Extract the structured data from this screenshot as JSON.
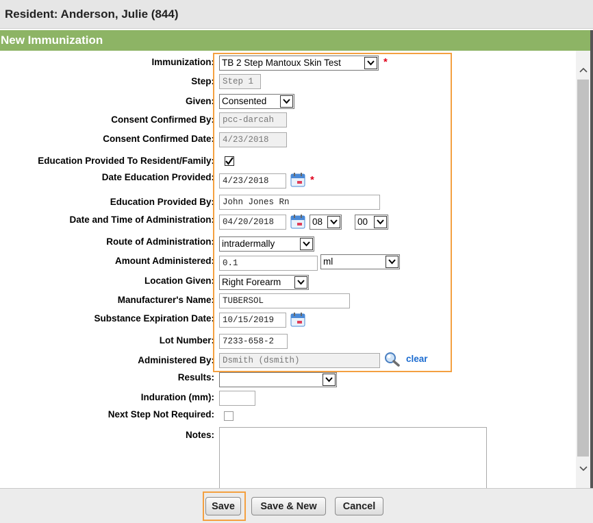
{
  "header": {
    "title": "Resident: Anderson, Julie (844)"
  },
  "section": {
    "title": "New Immunization"
  },
  "form": {
    "immunization": {
      "label": "Immunization:",
      "value": "TB 2 Step Mantoux Skin Test"
    },
    "step": {
      "label": "Step:",
      "value": "Step 1"
    },
    "given": {
      "label": "Given:",
      "value": "Consented"
    },
    "consent_by": {
      "label": "Consent Confirmed By:",
      "value": "pcc-darcah"
    },
    "consent_date": {
      "label": "Consent Confirmed Date:",
      "value": "4/23/2018"
    },
    "education_provided": {
      "label": "Education Provided To Resident/Family:",
      "checked": true
    },
    "date_education": {
      "label": "Date Education Provided:",
      "value": "4/23/2018"
    },
    "education_by": {
      "label": "Education Provided By:",
      "value": "John Jones Rn"
    },
    "admin_datetime": {
      "label": "Date and Time of Administration:",
      "date": "04/20/2018",
      "hour": "08",
      "minute": "00"
    },
    "route": {
      "label": "Route of Administration:",
      "value": "intradermally"
    },
    "amount": {
      "label": "Amount Administered:",
      "value": "0.1",
      "unit": "ml"
    },
    "location": {
      "label": "Location Given:",
      "value": "Right Forearm"
    },
    "manufacturer": {
      "label": "Manufacturer's Name:",
      "value": "TUBERSOL"
    },
    "expiration": {
      "label": "Substance Expiration Date:",
      "value": "10/15/2019"
    },
    "lot": {
      "label": "Lot Number:",
      "value": "7233-658-2"
    },
    "administered_by": {
      "label": "Administered By:",
      "value": "Dsmith (dsmith)",
      "clear_label": "clear"
    },
    "results": {
      "label": "Results:",
      "value": ""
    },
    "induration": {
      "label": "Induration (mm):",
      "value": ""
    },
    "next_step": {
      "label": "Next Step Not Required:",
      "checked": false
    },
    "notes": {
      "label": "Notes:",
      "value": ""
    },
    "required_mark": "*"
  },
  "footer": {
    "save_label": "Save",
    "save_new_label": "Save & New",
    "cancel_label": "Cancel"
  },
  "colors": {
    "section_bg": "#8db465",
    "highlight": "#f4a040",
    "required": "#e0001b",
    "link": "#1a6bd0"
  },
  "icons": {
    "calendar": "calendar-icon",
    "search": "magnifier-icon",
    "check": "checkmark-icon"
  }
}
